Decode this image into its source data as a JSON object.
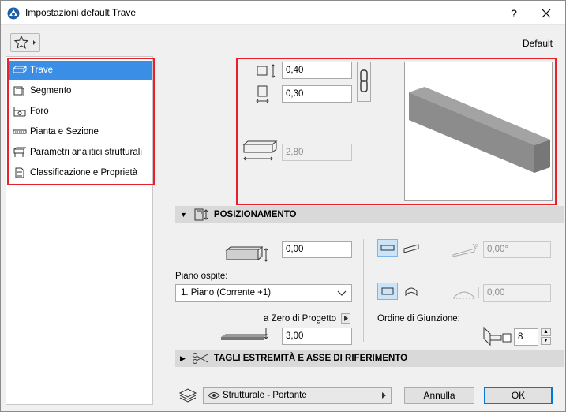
{
  "window": {
    "title": "Impostazioni default Trave",
    "help_label": "?"
  },
  "toolbar": {
    "default_label": "Default"
  },
  "sidebar": {
    "items": [
      {
        "label": "Trave",
        "icon": "beam-icon",
        "selected": true
      },
      {
        "label": "Segmento",
        "icon": "segment-icon"
      },
      {
        "label": "Foro",
        "icon": "hole-icon"
      },
      {
        "label": "Pianta e Sezione",
        "icon": "floor-plan-icon"
      },
      {
        "label": "Parametri analitici strutturali",
        "icon": "structural-analytics-icon"
      },
      {
        "label": "Classificazione e Proprietà",
        "icon": "properties-icon"
      }
    ]
  },
  "geometry": {
    "height_value": "0,40",
    "width_value": "0,30",
    "length_value": "2,80"
  },
  "positioning": {
    "header": "POSIZIONAMENTO",
    "offset_value": "0,00",
    "home_story_label": "Piano ospite:",
    "home_story_value": "1. Piano (Corrente +1)",
    "reference_label": "a Zero di Progetto",
    "reference_value": "3,00",
    "slant_angle_value": "0,00°",
    "arc_value": "0,00",
    "junction_order_label": "Ordine di Giunzione:",
    "junction_order_value": "8"
  },
  "end_cuts": {
    "header": "TAGLI ESTREMITÀ E ASSE DI RIFERIMENTO"
  },
  "footer": {
    "layer_value": "Strutturale - Portante",
    "cancel_label": "Annulla",
    "ok_label": "OK"
  },
  "colors": {
    "accent": "#3a8ee6",
    "highlight_frame": "#e8202a"
  }
}
